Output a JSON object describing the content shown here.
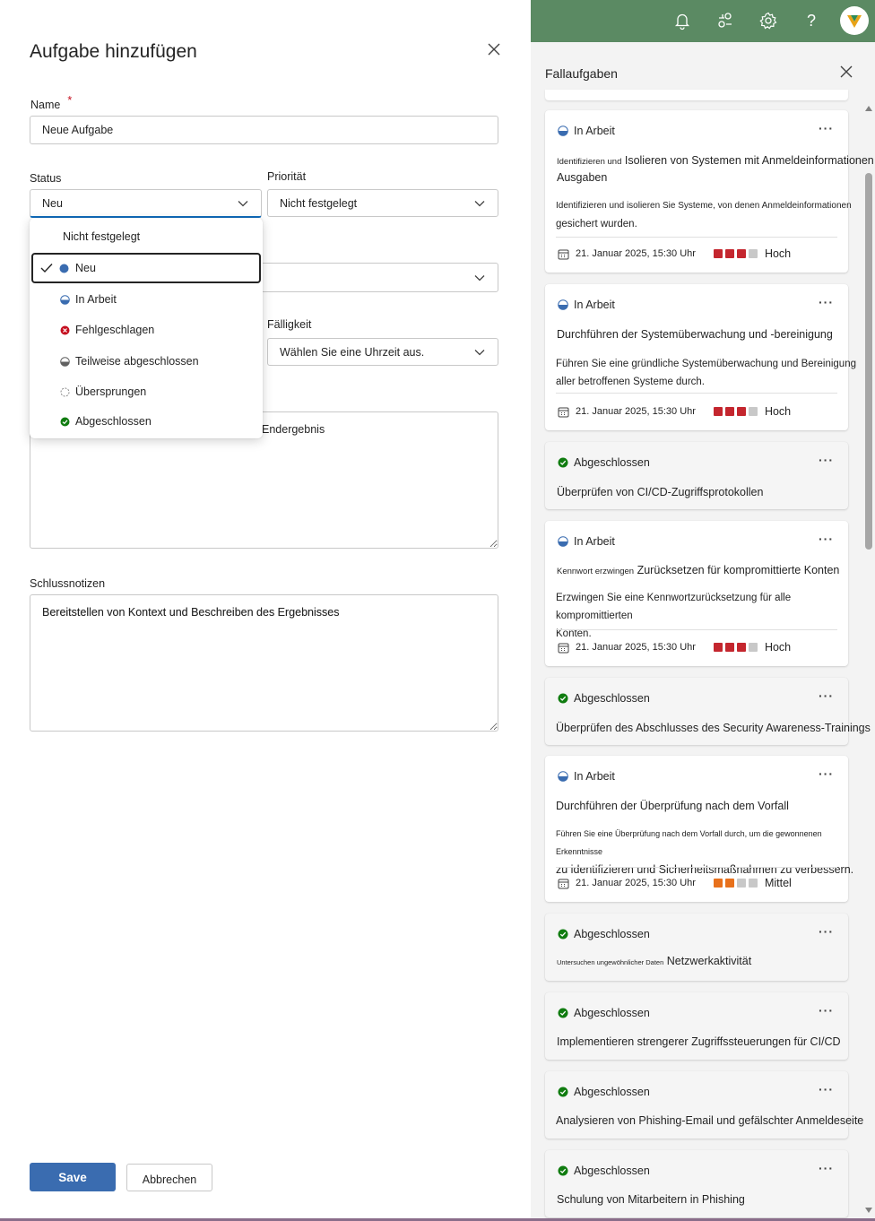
{
  "dialog": {
    "title": "Aufgabe hinzufügen",
    "name_label": "Name",
    "required_mark": "*",
    "name_value": "Neue Aufgabe",
    "status_label": "Status",
    "status_value": "Neu",
    "priority_label": "Priorität",
    "priority_value": "Nicht festgelegt",
    "due_label": "Fälligkeit",
    "due_value": "Wählen Sie eine Uhrzeit aus.",
    "outcome_partial_text": "Endergebnis",
    "closing_notes_label": "Schlussnotizen",
    "closing_notes_value": "Bereitstellen von Kontext und Beschreiben des Ergebnisses",
    "save_label": "Save",
    "cancel_label": "Abbrechen"
  },
  "status_dropdown": {
    "options": [
      {
        "label": "Nicht festgelegt",
        "icon": "none"
      },
      {
        "label": "Neu",
        "icon": "filled-blue-circle",
        "selected": true
      },
      {
        "label": "In Arbeit",
        "icon": "half-circle"
      },
      {
        "label": "Fehlgeschlagen",
        "icon": "red-x-circle"
      },
      {
        "label": "Teilweise abgeschlossen",
        "icon": "half-gray-circle"
      },
      {
        "label": "Übersprungen",
        "icon": "dashed-circle"
      },
      {
        "label": "Abgeschlossen",
        "icon": "green-check-circle"
      }
    ]
  },
  "topbar": {
    "icons": [
      "bell-icon",
      "share-icon",
      "gear-icon",
      "help-icon"
    ],
    "help_glyph": "?"
  },
  "panel": {
    "title": "Fallaufgaben",
    "more_glyph": "···",
    "cards": [
      {
        "status": "In Arbeit",
        "title_small": "Identifizieren und",
        "title": "Isolieren von Systemen mit Anmeldeinformationen",
        "title_line2": "Ausgaben",
        "desc_small": "Identifizieren und isolieren Sie Systeme, von denen Anmeldeinformationen",
        "desc_line2": "gesichert wurden.",
        "date": "21. Januar 2025, 15:30 Uhr",
        "priority": "Hoch"
      },
      {
        "status": "In Arbeit",
        "title": "Durchführen der Systemüberwachung und -bereinigung",
        "desc": "Führen Sie eine gründliche Systemüberwachung und Bereinigung",
        "desc_line2": "aller betroffenen Systeme durch.",
        "date": "21. Januar 2025, 15:30 Uhr",
        "priority": "Hoch"
      },
      {
        "status": "Abgeschlossen",
        "title": "Überprüfen von CI/CD-Zugriffsprotokollen"
      },
      {
        "status": "In Arbeit",
        "title_small": "Kennwort erzwingen",
        "title": "Zurücksetzen für kompromittierte Konten",
        "desc": "Erzwingen Sie eine Kennwortzurücksetzung für alle kompromittierten",
        "desc_line2": "Konten.",
        "date": "21. Januar 2025, 15:30 Uhr",
        "priority": "Hoch"
      },
      {
        "status": "Abgeschlossen",
        "title": "Überprüfen des Abschlusses des Security Awareness-Trainings"
      },
      {
        "status": "In Arbeit",
        "title": "Durchführen der Überprüfung nach dem Vorfall",
        "desc_small": "Führen Sie eine Überprüfung nach dem Vorfall durch, um die gewonnenen Erkenntnisse",
        "desc_line2": "zu identifizieren und Sicherheitsmaßnahmen zu verbessern.",
        "date": "21. Januar 2025, 15:30 Uhr",
        "priority": "Mittel"
      },
      {
        "status": "Abgeschlossen",
        "title_small": "Untersuchen ungewöhnlicher Daten",
        "title": "Netzwerkaktivität"
      },
      {
        "status": "Abgeschlossen",
        "title": "Implementieren strengerer Zugriffssteuerungen für CI/CD"
      },
      {
        "status": "Abgeschlossen",
        "title": "Analysieren von Phishing-Email und gefälschter Anmeldeseite"
      },
      {
        "status": "Abgeschlossen",
        "title": "Schulung von Mitarbeitern in Phishing"
      }
    ]
  },
  "colors": {
    "accent": "#0f6cbd",
    "save_button": "#3a6cb0",
    "topbar": "#5b8a63",
    "priority_high": "#c4262e",
    "priority_medium": "#e8711c",
    "priority_empty": "#c8c8c8",
    "status_done": "#107c10",
    "status_failed": "#c50f1f"
  }
}
